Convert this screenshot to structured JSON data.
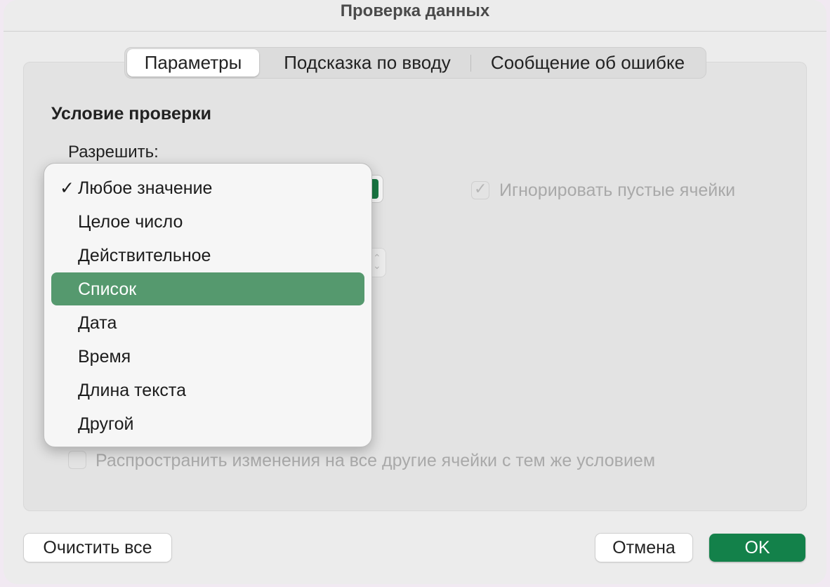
{
  "window": {
    "title": "Проверка данных"
  },
  "tabs": [
    {
      "label": "Параметры",
      "active": true
    },
    {
      "label": "Подсказка по вводу",
      "active": false
    },
    {
      "label": "Сообщение об ошибке",
      "active": false
    }
  ],
  "criteria": {
    "heading": "Условие проверки",
    "allow_label": "Разрешить:",
    "ignore_blank": {
      "label": "Игнорировать пустые ячейки",
      "checked": true,
      "enabled": false
    },
    "apply_all": {
      "label": "Распространить изменения на все другие ячейки с тем же условием",
      "checked": false,
      "enabled": false
    }
  },
  "allow_menu": {
    "items": [
      {
        "label": "Любое значение",
        "checked": true
      },
      {
        "label": "Целое число"
      },
      {
        "label": "Действительное"
      },
      {
        "label": "Список",
        "highlighted": true
      },
      {
        "label": "Дата"
      },
      {
        "label": "Время"
      },
      {
        "label": "Длина текста"
      },
      {
        "label": "Другой"
      }
    ],
    "check_glyph": "✓"
  },
  "buttons": {
    "clear_all": "Очистить все",
    "cancel": "Отмена",
    "ok": "OK"
  },
  "colors": {
    "accent": "#13814a",
    "menu_highlight": "#55996e"
  }
}
